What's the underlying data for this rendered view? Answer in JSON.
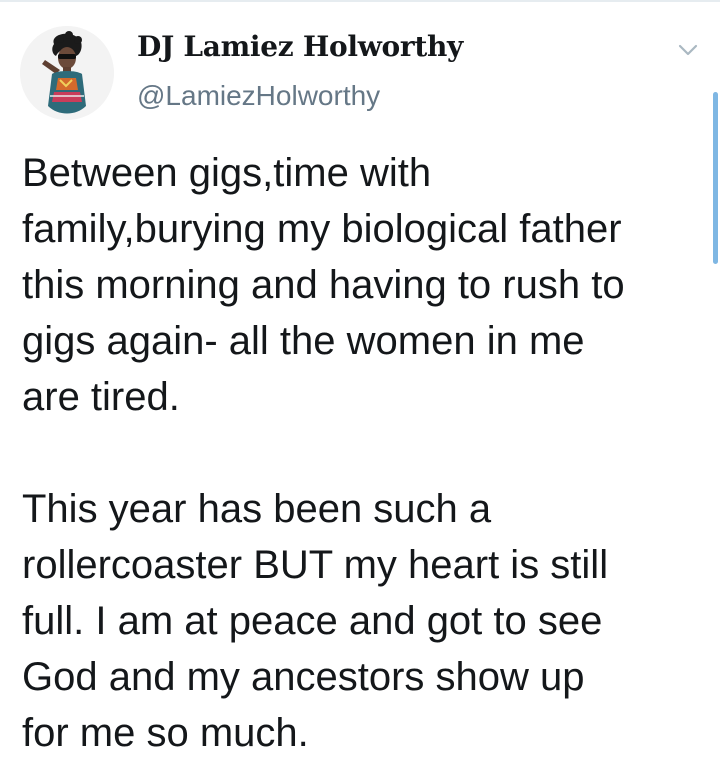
{
  "user": {
    "display_name": "DJ Lamiez Holworthy",
    "handle": "@LamiezHolworthy"
  },
  "tweet": {
    "paragraphs": [
      "Between gigs,time with\nfamily,burying my biological father\nthis morning and having to rush to\ngigs again- all the women in me\nare tired.",
      "This year has been such a\nrollercoaster BUT my heart is still\nfull. I am at peace and got to see\nGod and my ancestors show up\nfor me so much."
    ]
  },
  "icons": {
    "menu": "chevron-down-icon",
    "avatar": "avatar"
  }
}
